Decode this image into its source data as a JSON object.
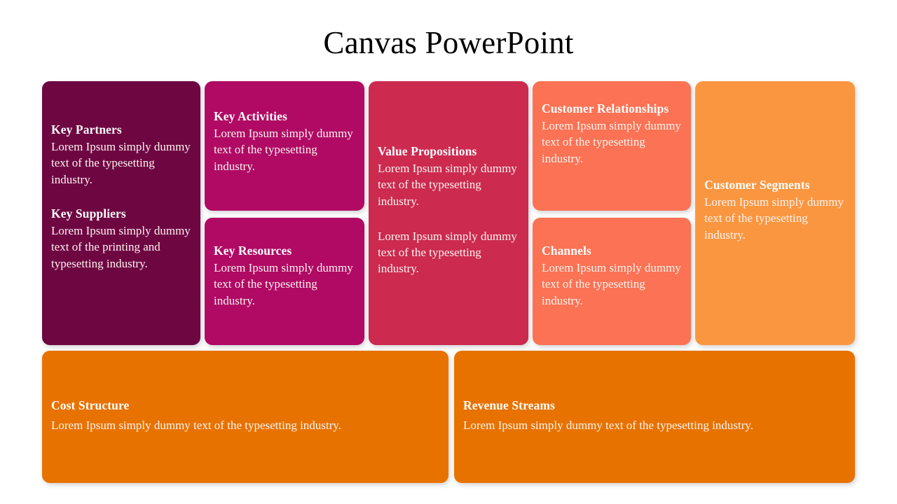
{
  "slide": {
    "title": "Canvas PowerPoint",
    "background": "#ffffff"
  },
  "palette": {
    "key_partners": "#6e0642",
    "key_activities": "#b00a64",
    "value_propositions": "#cc2a4f",
    "customer_relationships": "#fb7254",
    "customer_segments": "#fb9640",
    "bottom_row": "#e87200",
    "heading_text": "#ffffff",
    "body_text": "#fdf4f0",
    "title_text": "#000000"
  },
  "canvas": {
    "key_partners": {
      "blocks": [
        {
          "heading": "Key Partners",
          "body": "Lorem Ipsum simply dummy text of the typesetting industry."
        },
        {
          "heading": "Key Suppliers",
          "body": "Lorem Ipsum simply dummy text of the printing and typesetting industry."
        }
      ]
    },
    "key_activities": {
      "heading": "Key Activities",
      "body": "Lorem Ipsum simply dummy text of the typesetting industry."
    },
    "key_resources": {
      "heading": "Key Resources",
      "body": "Lorem Ipsum simply dummy text of the typesetting industry."
    },
    "value_propositions": {
      "heading": "Value Propositions",
      "body": "Lorem Ipsum simply dummy text of the typesetting industry.",
      "body2": "Lorem Ipsum simply dummy text of the typesetting industry."
    },
    "customer_relationships": {
      "heading": "Customer Relationships",
      "body": "Lorem Ipsum simply dummy text of the typesetting industry."
    },
    "channels": {
      "heading": "Channels",
      "body": "Lorem Ipsum simply dummy text of the typesetting industry."
    },
    "customer_segments": {
      "heading": "Customer Segments",
      "body": "Lorem Ipsum simply dummy text of the typesetting industry."
    },
    "cost_structure": {
      "heading": "Cost Structure",
      "body": "Lorem Ipsum simply dummy text of the typesetting industry."
    },
    "revenue_streams": {
      "heading": "Revenue Streams",
      "body": "Lorem Ipsum simply dummy text of the typesetting industry."
    }
  }
}
